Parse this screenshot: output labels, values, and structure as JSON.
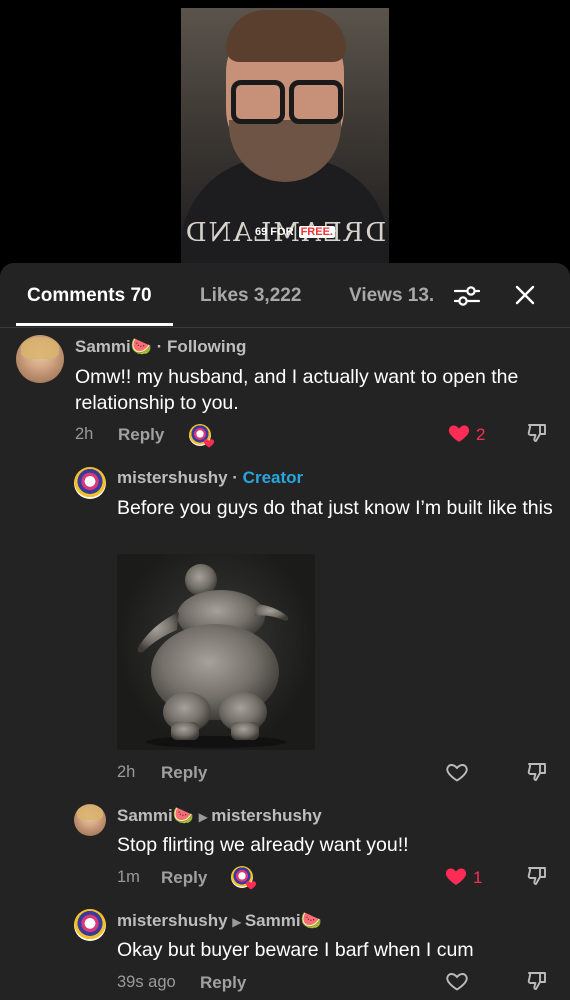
{
  "video": {
    "overlay_text": "69 FOR",
    "overlay_highlight": "FREE.",
    "shirt_text": "DREAMLAND"
  },
  "tabs": {
    "comments": "Comments 70",
    "likes": "Likes 3,222",
    "views": "Views 13."
  },
  "comments": [
    {
      "username": "Sammi🍉",
      "badge": "Following",
      "text": "Omw!! my husband, and I actually want to open the relationship to you.",
      "time": "2h",
      "reply_label": "Reply",
      "likes": "2",
      "liked": true,
      "liked_by_creator": true
    },
    {
      "username": "mistershushy",
      "badge": "Creator",
      "text": "Before you guys do that just know I’m built like this",
      "time": "2h",
      "reply_label": "Reply",
      "likes": "",
      "liked": false,
      "has_image": true
    },
    {
      "username": "Sammi🍉",
      "reply_to": "mistershushy",
      "text": "Stop flirting we already want you!!",
      "time": "1m",
      "reply_label": "Reply",
      "likes": "1",
      "liked": true,
      "liked_by_creator": true
    },
    {
      "username": "mistershushy",
      "reply_to": "Sammi🍉",
      "text": "Okay but buyer beware I barf when I cum",
      "time": "39s ago",
      "reply_label": "Reply",
      "likes": "",
      "liked": false
    }
  ],
  "colors": {
    "sheet_bg": "#232323",
    "like_red": "#ff2d55",
    "creator_blue": "#27a6e0"
  }
}
